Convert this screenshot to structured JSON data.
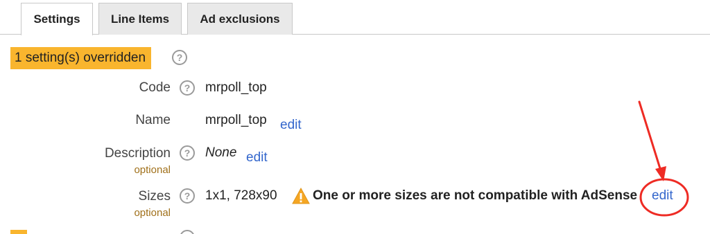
{
  "tabs": [
    {
      "label": "Settings",
      "active": true
    },
    {
      "label": "Line Items",
      "active": false
    },
    {
      "label": "Ad exclusions",
      "active": false
    }
  ],
  "override_badge": "1 setting(s) overridden",
  "help_glyph": "?",
  "fields": {
    "code": {
      "label": "Code",
      "value": "mrpoll_top"
    },
    "name": {
      "label": "Name",
      "value": "mrpoll_top",
      "edit": "edit"
    },
    "description": {
      "label": "Description",
      "optional": "optional",
      "value": "None",
      "edit": "edit"
    },
    "sizes": {
      "label": "Sizes",
      "optional": "optional",
      "value": "1x1, 728x90",
      "warning": "One or more sizes are not compatible with AdSense",
      "edit": "edit"
    }
  },
  "colors": {
    "badge": "#f9b52e",
    "link": "#3366cc",
    "optional": "#a0701a",
    "annotation": "#ee2b24",
    "warning": "#f5a623"
  },
  "icons": {
    "help": "help-circle-icon",
    "warning": "warning-triangle-icon"
  }
}
